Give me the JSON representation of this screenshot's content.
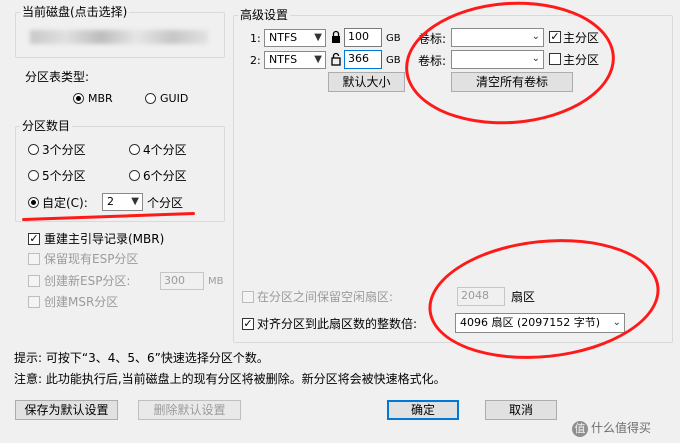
{
  "disk": {
    "title": "当前磁盘(点击选择)"
  },
  "partition_table": {
    "title": "分区表类型:",
    "options": [
      "MBR",
      "GUID"
    ],
    "selected": "MBR"
  },
  "partition_count": {
    "title": "分区数目",
    "options": [
      "3个分区",
      "4个分区",
      "5个分区",
      "6个分区"
    ],
    "custom_label": "自定(C):",
    "custom_value": "2",
    "custom_suffix": "个分区"
  },
  "options": {
    "rebuild_mbr": "重建主引导记录(MBR)",
    "keep_esp": "保留现有ESP分区",
    "create_esp": "创建新ESP分区:",
    "esp_size": "300",
    "esp_unit": "MB",
    "create_msr": "创建MSR分区"
  },
  "advanced": {
    "title": "高级设置",
    "rows": [
      {
        "index": "1:",
        "fs": "NTFS",
        "size": "100",
        "unit": "GB",
        "vol_label": "卷标:",
        "vol_value": "",
        "primary_label": "主分区",
        "primary_checked": true
      },
      {
        "index": "2:",
        "fs": "NTFS",
        "size": "366",
        "unit": "GB",
        "vol_label": "卷标:",
        "vol_value": "",
        "primary_label": "主分区",
        "primary_checked": false
      }
    ],
    "default_size_btn": "默认大小",
    "clear_labels_btn": "清空所有卷标"
  },
  "align": {
    "keep_free_label": "在分区之间保留空闲扇区:",
    "keep_free_value": "2048",
    "keep_free_unit": "扇区",
    "align_label": "对齐分区到此扇区数的整数倍:",
    "align_value": "4096 扇区 (2097152 字节)"
  },
  "notes": {
    "tip": "提示: 可按下“3、4、5、6”快速选择分区个数。",
    "warning": "注意: 此功能执行后,当前磁盘上的现有分区将被删除。新分区将会被快速格式化。"
  },
  "buttons": {
    "save_default": "保存为默认设置",
    "delete_default": "删除默认设置",
    "ok": "确定",
    "cancel": "取消"
  },
  "watermark": "值 什么值得买",
  "colors": {
    "annotation_red": "#ff1a1a",
    "focus_blue": "#0078d7"
  }
}
